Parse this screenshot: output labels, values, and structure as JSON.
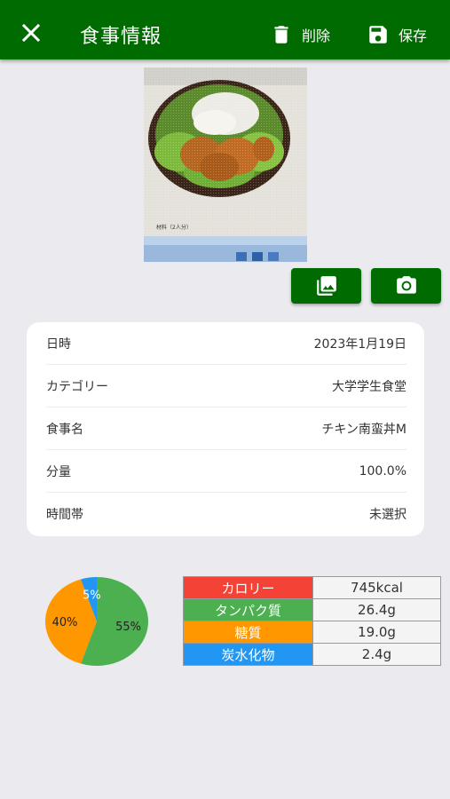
{
  "header": {
    "title": "食事情報",
    "delete_label": "削除",
    "save_label": "保存"
  },
  "photo": {
    "caption": "材料（2人分）"
  },
  "details": [
    {
      "label": "日時",
      "value": "2023年1月19日"
    },
    {
      "label": "カテゴリー",
      "value": "大学学生食堂"
    },
    {
      "label": "食事名",
      "value": "チキン南蛮丼M"
    },
    {
      "label": "分量",
      "value": "100.0%"
    },
    {
      "label": "時間帯",
      "value": "未選択"
    }
  ],
  "chart_data": {
    "type": "pie",
    "slices": [
      {
        "label": "55%",
        "value": 55,
        "color": "#4caf50"
      },
      {
        "label": "40%",
        "value": 40,
        "color": "#ff9800"
      },
      {
        "label": "5%",
        "value": 5,
        "color": "#2196f3"
      }
    ]
  },
  "nutrition": [
    {
      "name": "カロリー",
      "value": "745kcal",
      "color": "#f44336"
    },
    {
      "name": "タンパク質",
      "value": "26.4g",
      "color": "#4caf50"
    },
    {
      "name": "糖質",
      "value": "19.0g",
      "color": "#ff9800"
    },
    {
      "name": "炭水化物",
      "value": "2.4g",
      "color": "#2196f3"
    }
  ]
}
